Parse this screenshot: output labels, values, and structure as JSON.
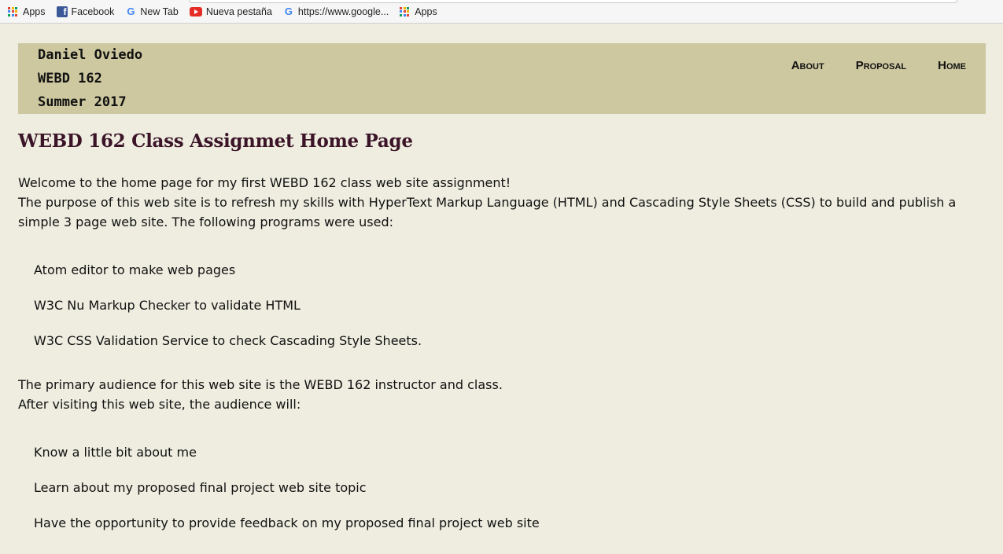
{
  "bookmarks": [
    {
      "label": "Apps",
      "icon": "apps-grid-icon"
    },
    {
      "label": "Facebook",
      "icon": "facebook-icon"
    },
    {
      "label": "New Tab",
      "icon": "google-icon"
    },
    {
      "label": "Nueva pestaña",
      "icon": "youtube-icon"
    },
    {
      "label": "https://www.google...",
      "icon": "google-icon"
    },
    {
      "label": "Apps",
      "icon": "apps-grid-icon"
    }
  ],
  "header": {
    "name": "Daniel Oviedo",
    "course": "WEBD 162",
    "term": "Summer 2017",
    "background": "#cdc8a0"
  },
  "nav": {
    "about": "About",
    "proposal": "Proposal",
    "home": "Home"
  },
  "main": {
    "title": "WEBD 162 Class Assignmet Home Page",
    "title_color": "#3c1428",
    "intro_line1": "Welcome to the home page for my first WEBD 162 class web site assignment!",
    "intro_line2": "The purpose of this web site is to refresh my skills with HyperText Markup Language (HTML) and Cascading Style Sheets (CSS) to build and publish a simple 3 page web site. The following programs were used:",
    "programs": [
      "Atom editor to make web pages",
      "W3C Nu Markup Checker to validate HTML",
      "W3C CSS Validation Service to check Cascading Style Sheets."
    ],
    "audience_line1": "The primary audience for this web site is the WEBD 162 instructor and class.",
    "audience_line2": "After visiting this web site, the audience will:",
    "outcomes": [
      "Know a little bit about me",
      "Learn about my proposed final project web site topic",
      "Have the opportunity to provide feedback on my proposed final project web site"
    ]
  }
}
